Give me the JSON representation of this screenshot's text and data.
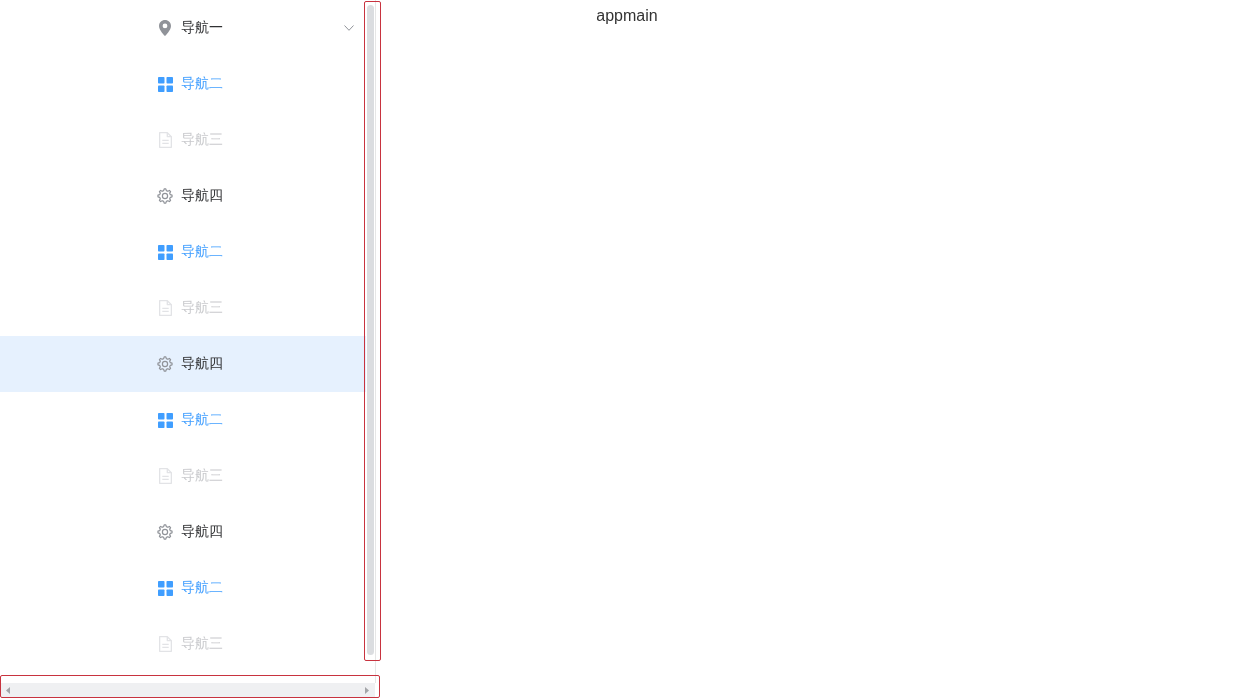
{
  "sidebar": {
    "menu": [
      {
        "kind": "submenu",
        "label": "导航一",
        "expanded": false,
        "selected": false,
        "disabled": false,
        "hovered": false
      },
      {
        "kind": "item",
        "label": "导航二",
        "selected": true,
        "disabled": false,
        "hovered": false
      },
      {
        "kind": "item",
        "label": "导航三",
        "selected": false,
        "disabled": true,
        "hovered": false
      },
      {
        "kind": "item",
        "label": "导航四",
        "selected": false,
        "disabled": false,
        "hovered": false
      },
      {
        "kind": "item",
        "label": "导航二",
        "selected": true,
        "disabled": false,
        "hovered": false
      },
      {
        "kind": "item",
        "label": "导航三",
        "selected": false,
        "disabled": true,
        "hovered": false
      },
      {
        "kind": "item",
        "label": "导航四",
        "selected": false,
        "disabled": false,
        "hovered": true
      },
      {
        "kind": "item",
        "label": "导航二",
        "selected": true,
        "disabled": false,
        "hovered": false
      },
      {
        "kind": "item",
        "label": "导航三",
        "selected": false,
        "disabled": true,
        "hovered": false
      },
      {
        "kind": "item",
        "label": "导航四",
        "selected": false,
        "disabled": false,
        "hovered": false
      },
      {
        "kind": "item",
        "label": "导航二",
        "selected": true,
        "disabled": false,
        "hovered": false
      },
      {
        "kind": "item",
        "label": "导航三",
        "selected": false,
        "disabled": true,
        "hovered": false
      }
    ],
    "vertical_scrollbar": {
      "highlighted": true
    },
    "horizontal_scrollbar": {
      "highlighted": true
    }
  },
  "main": {
    "text": "appmain"
  }
}
